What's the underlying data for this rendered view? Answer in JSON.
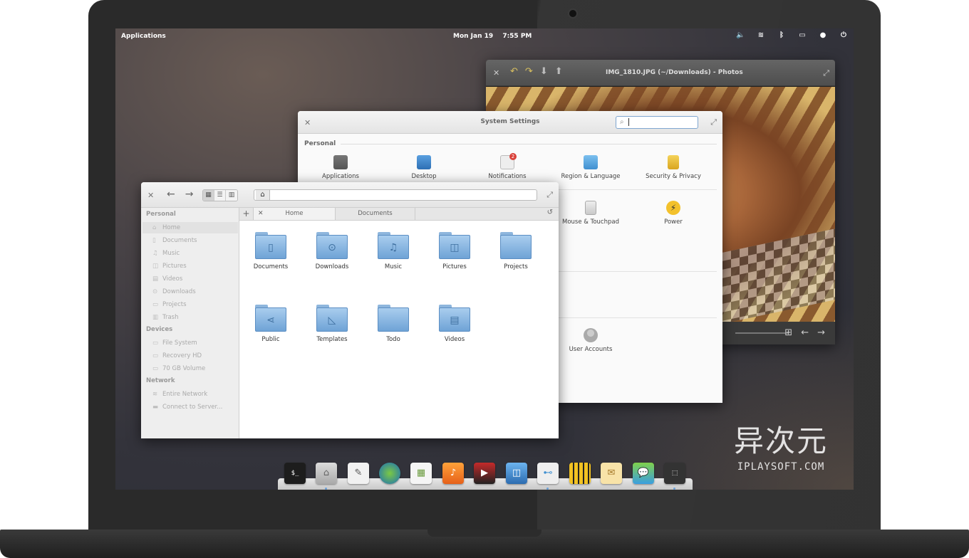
{
  "top_panel": {
    "applications": "Applications",
    "date": "Mon Jan 19",
    "time": "7:55 PM",
    "indicators": [
      "volume-icon",
      "wifi-icon",
      "bluetooth-icon",
      "battery-icon",
      "notification-bell-icon",
      "power-icon"
    ]
  },
  "photos": {
    "title": "IMG_1810.JPG (~/Downloads) - Photos"
  },
  "settings": {
    "title": "System Settings",
    "search_placeholder": "",
    "section_personal": "Personal",
    "items_row1": [
      "Applications",
      "Desktop",
      "Notifications",
      "Region & Language",
      "Security & Privacy"
    ],
    "items_row2": [
      "Mouse & Touchpad",
      "Power"
    ],
    "items_row4": [
      "User Accounts"
    ],
    "notification_badge": "2"
  },
  "files": {
    "sidebar": {
      "personal_label": "Personal",
      "personal": [
        "Home",
        "Documents",
        "Music",
        "Pictures",
        "Videos",
        "Downloads",
        "Projects",
        "Trash"
      ],
      "devices_label": "Devices",
      "devices": [
        "File System",
        "Recovery HD",
        "70 GB Volume"
      ],
      "network_label": "Network",
      "network": [
        "Entire Network",
        "Connect to Server..."
      ]
    },
    "tabs": [
      "Home",
      "Documents"
    ],
    "folders": [
      "Documents",
      "Downloads",
      "Music",
      "Pictures",
      "Projects",
      "Public",
      "Templates",
      "Todo",
      "Videos"
    ]
  },
  "dock": {
    "apps": [
      "terminal",
      "files",
      "text-editor",
      "browser",
      "calendar",
      "music",
      "videos",
      "photos",
      "settings",
      "taxi",
      "mail",
      "messages",
      "screenshot"
    ]
  },
  "watermark": {
    "cn": "异次元",
    "en": "IPLAYSOFT.COM"
  },
  "colors": {
    "accent": "#6fa3d6",
    "panel_text": "#ffffff"
  }
}
